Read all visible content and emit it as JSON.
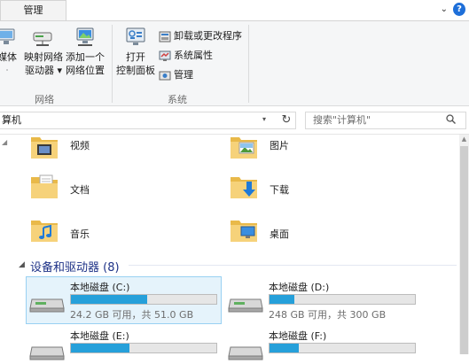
{
  "ribbon": {
    "tab_label": "管理",
    "controls": {
      "expand_glyph": "⌄",
      "help_glyph": "?"
    },
    "media_button": {
      "line1": "媒体",
      "line2": "·"
    },
    "map_drive": {
      "line1": "映射网络",
      "line2": "驱动器 ▾"
    },
    "add_location": {
      "line1": "添加一个",
      "line2": "网络位置"
    },
    "network_group_label": "网络",
    "open_control_panel": {
      "line1": "打开",
      "line2": "控制面板"
    },
    "uninstall": "卸载或更改程序",
    "system_properties": "系统属性",
    "manage": "管理",
    "system_group_label": "系统"
  },
  "address": {
    "path": "算机",
    "dropdown_glyph": "▾",
    "refresh_glyph": "↻",
    "search_placeholder": "搜索\"计算机\""
  },
  "folders": [
    {
      "label": "视频",
      "icon": "video-folder-icon"
    },
    {
      "label": "图片",
      "icon": "pictures-folder-icon"
    },
    {
      "label": "文档",
      "icon": "documents-folder-icon"
    },
    {
      "label": "下载",
      "icon": "downloads-folder-icon"
    },
    {
      "label": "音乐",
      "icon": "music-folder-icon"
    },
    {
      "label": "桌面",
      "icon": "desktop-folder-icon"
    }
  ],
  "devices_section": {
    "title": "设备和驱动器 (8)",
    "arrow": "◢"
  },
  "drives": [
    {
      "name": "本地磁盘 (C:)",
      "free": "24.2 GB 可用，共 51.0 GB",
      "used_fraction": 0.525,
      "selected": true
    },
    {
      "name": "本地磁盘 (D:)",
      "free": "248 GB 可用，共 300 GB",
      "used_fraction": 0.17,
      "selected": false
    },
    {
      "name": "本地磁盘 (E:)",
      "free": "",
      "used_fraction": 0.4,
      "selected": false
    },
    {
      "name": "本地磁盘 (F:)",
      "free": "",
      "used_fraction": 0.2,
      "selected": false
    }
  ],
  "colors": {
    "accent": "#26a0da",
    "selection_bg": "#e5f3fb",
    "selection_border": "#99d1f2",
    "section_title": "#1e3287",
    "folder_yellow": "#f6d27a"
  }
}
